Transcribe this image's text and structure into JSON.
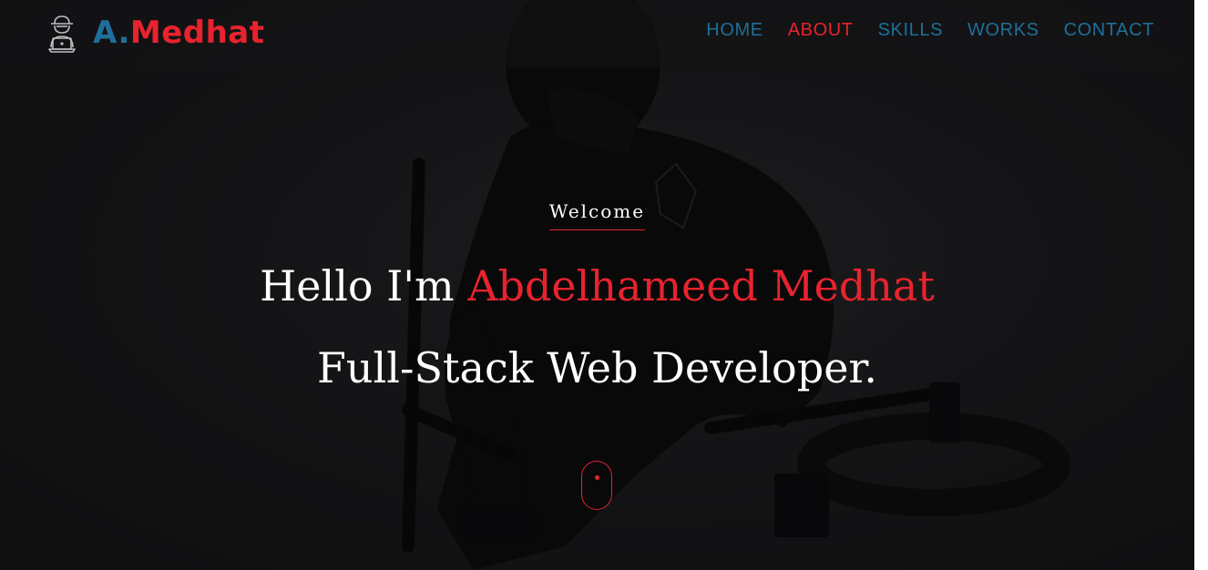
{
  "brand": {
    "prefix": "A.",
    "name": "Medhat",
    "icon": "hacker-laptop-icon"
  },
  "nav": {
    "items": [
      {
        "label": "HOME",
        "active": false
      },
      {
        "label": "ABOUT",
        "active": true
      },
      {
        "label": "SKILLS",
        "active": false
      },
      {
        "label": "WORKS",
        "active": false
      },
      {
        "label": "CONTACT",
        "active": false
      }
    ]
  },
  "hero": {
    "welcome": "Welcome",
    "greeting": "Hello I'm",
    "name": "Abdelhameed Medhat",
    "role": "Full-Stack Web Developer.",
    "scroll_icon": "mouse-scroll-icon"
  },
  "colors": {
    "accent": "#e8232d",
    "brand_blue": "#1f6f9a",
    "background": "#141416",
    "text": "#ffffff"
  }
}
